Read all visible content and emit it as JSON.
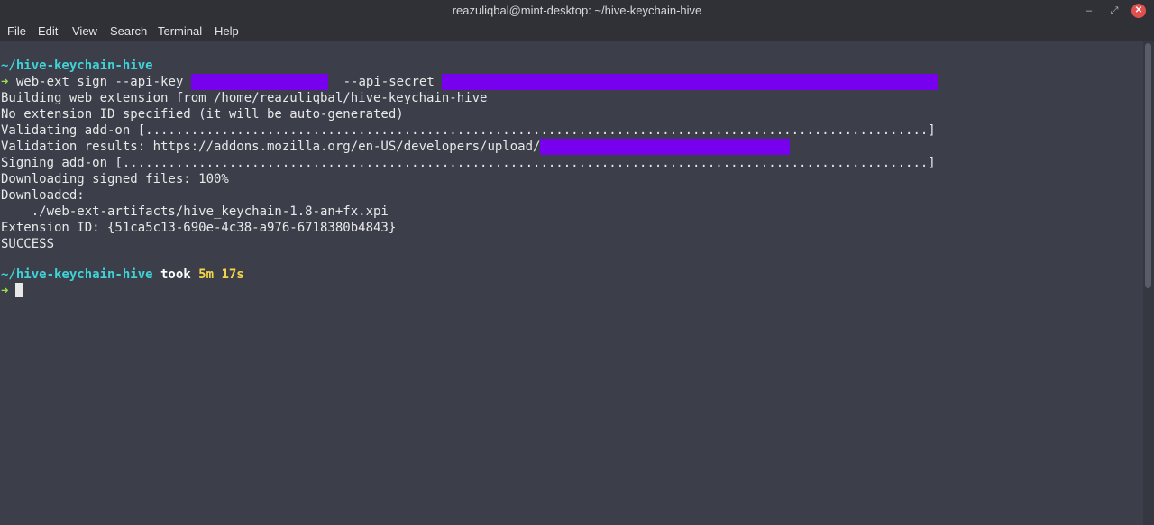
{
  "window": {
    "title": "reazuliqbal@mint-desktop: ~/hive-keychain-hive",
    "minimize_glyph": "‒",
    "maximize_glyph": "⤢",
    "close_glyph": "✕"
  },
  "menu": [
    "File",
    "Edit",
    "View",
    "Search",
    "Terminal",
    "Help"
  ],
  "terminal": {
    "cwd": "~/hive-keychain-hive",
    "prompt_symbol": "➜",
    "command_part1": " web-ext sign --api-key",
    "command_part2": " --api-secret",
    "output": [
      "Building web extension from /home/reazuliqbal/hive-keychain-hive",
      "No extension ID specified (it will be auto-generated)",
      "Validating add-on [.......................................................................................................]",
      "Validation results: https://addons.mozilla.org/en-US/developers/upload/",
      "Signing add-on [..........................................................................................................]",
      "Downloading signed files: 100%",
      "Downloaded:",
      "    ./web-ext-artifacts/hive_keychain-1.8-an+fx.xpi",
      "Extension ID: {51ca5c13-690e-4c38-a976-6718380b4843}",
      "SUCCESS"
    ],
    "took_label": " took ",
    "took_time": "5m 17s"
  },
  "colors": {
    "background": "#3c3f4a",
    "redaction": "#7700ee",
    "directory": "#3fd3d8",
    "prompt_arrow": "#9be24a",
    "duration": "#f5d547"
  }
}
